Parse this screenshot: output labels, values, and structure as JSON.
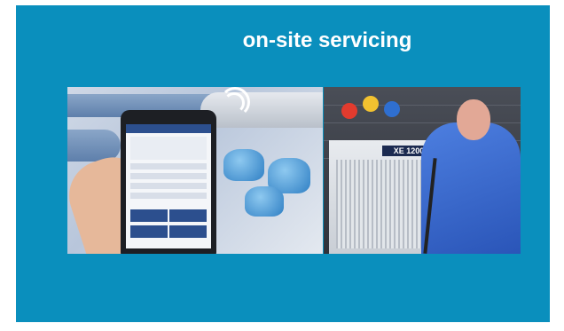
{
  "slide": {
    "title": "on-site servicing",
    "background_color": "#0a8fbd"
  },
  "photos": {
    "right": {
      "unit_label": "XE 1200"
    }
  }
}
